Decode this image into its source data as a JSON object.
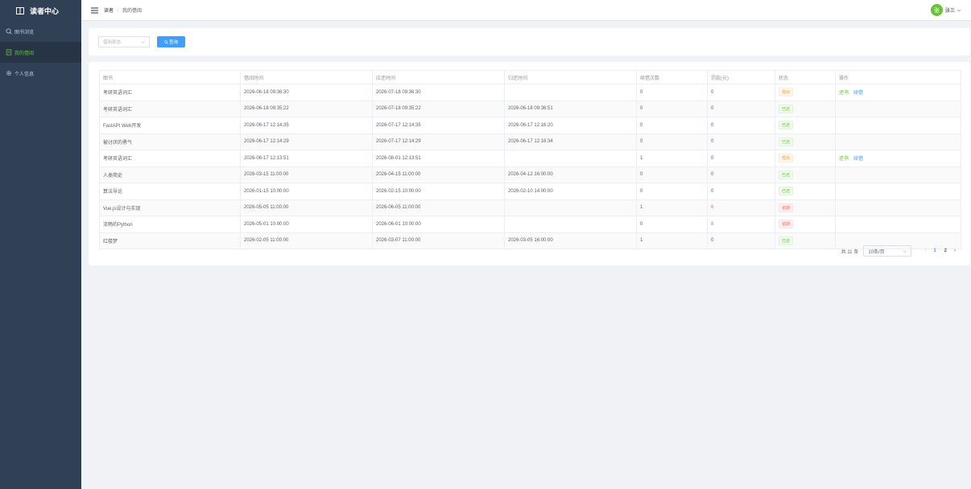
{
  "brand": {
    "title": "读者中心"
  },
  "sidebar": {
    "items": [
      {
        "label": "图书浏览",
        "icon": "search-icon"
      },
      {
        "label": "我的借阅",
        "icon": "document-icon",
        "active": true
      },
      {
        "label": "个人信息",
        "icon": "gear-icon"
      }
    ]
  },
  "header": {
    "breadcrumb": {
      "root": "读者",
      "sep": "/",
      "current": "我的借阅"
    },
    "user": {
      "avatar_text": "张",
      "name": "张三"
    }
  },
  "search": {
    "status_placeholder": "借阅状态",
    "query_label": "查询"
  },
  "table": {
    "columns": [
      "图书",
      "借阅时间",
      "应还时间",
      "归还时间",
      "续借次数",
      "罚款(元)",
      "状态",
      "操作"
    ],
    "rows": [
      {
        "book": "考研英语词汇",
        "borrow": "2026-06-18 09:36:30",
        "due": "2026-07-18 09:36:30",
        "ret": "",
        "renew": "0",
        "fine": "0",
        "status": "借出",
        "ops": [
          "还书",
          "续借"
        ]
      },
      {
        "book": "考研英语词汇",
        "borrow": "2026-06-18 09:35:22",
        "due": "2026-07-18 09:35:22",
        "ret": "2026-06-18 09:36:51",
        "renew": "0",
        "fine": "0",
        "status": "已还",
        "ops": []
      },
      {
        "book": "FastAPI Web开发",
        "borrow": "2026-06-17 12:14:35",
        "due": "2026-07-17 12:14:35",
        "ret": "2026-06-17 12:16:20",
        "renew": "0",
        "fine": "0",
        "status": "已还",
        "ops": []
      },
      {
        "book": "被讨厌的勇气",
        "borrow": "2026-06-17 12:14:29",
        "due": "2026-07-17 12:14:29",
        "ret": "2026-06-17 12:16:34",
        "renew": "0",
        "fine": "0",
        "status": "已还",
        "ops": []
      },
      {
        "book": "考研英语词汇",
        "borrow": "2026-06-17 12:13:51",
        "due": "2026-08-01 12:13:51",
        "ret": "",
        "renew": "1",
        "fine": "0",
        "status": "借出",
        "ops": [
          "还书",
          "续借"
        ]
      },
      {
        "book": "人类简史",
        "borrow": "2026-03-15 11:00:00",
        "due": "2026-04-15 11:00:00",
        "ret": "2026-04-12 16:00:00",
        "renew": "0",
        "fine": "0",
        "status": "已还",
        "ops": []
      },
      {
        "book": "算法导论",
        "borrow": "2026-01-15 10:00:00",
        "due": "2026-02-15 10:00:00",
        "ret": "2026-02-10 14:00:00",
        "renew": "0",
        "fine": "0",
        "status": "已还",
        "ops": []
      },
      {
        "book": "Vue.js设计与实现",
        "borrow": "2026-05-05 11:00:00",
        "due": "2026-06-05 11:00:00",
        "ret": "",
        "renew": "1",
        "fine": "6",
        "status": "逾期",
        "ops": []
      },
      {
        "book": "流畅的Python",
        "borrow": "2026-05-01 10:00:00",
        "due": "2026-06-01 10:00:00",
        "ret": "",
        "renew": "0",
        "fine": "8",
        "status": "逾期",
        "ops": []
      },
      {
        "book": "红楼梦",
        "borrow": "2026-02-05 11:00:00",
        "due": "2026-03-07 11:00:00",
        "ret": "2026-03-05 16:00:00",
        "renew": "1",
        "fine": "0",
        "status": "已还",
        "ops": []
      }
    ]
  },
  "pagination": {
    "total_label": "共 11 条",
    "page_size": "10条/页",
    "pages": [
      "1",
      "2"
    ],
    "current": "1"
  },
  "colors": {
    "sidebar_bg": "#304156",
    "active_green": "#67c23a",
    "primary_blue": "#409eff",
    "danger_red": "#f56c6c",
    "warning_orange": "#e6a23c"
  }
}
